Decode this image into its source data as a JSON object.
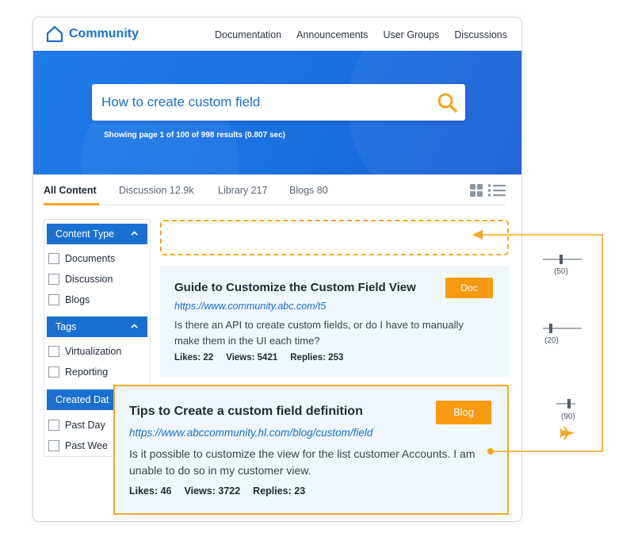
{
  "app": {
    "title": "Community"
  },
  "nav": [
    "Documentation",
    "Announcements",
    "User Groups",
    "Discussions"
  ],
  "search": {
    "value": "How to create custom field",
    "results_text": "Showing page 1 of 100 of 998 results (0.807 sec)"
  },
  "tabs": [
    {
      "label": "All Content"
    },
    {
      "label": "Discussion 12.9k"
    },
    {
      "label": "Library 217"
    },
    {
      "label": "Blogs 80"
    }
  ],
  "filters": {
    "content_type": {
      "header": "Content Type",
      "items": [
        "Documents",
        "Discussion",
        "Blogs"
      ]
    },
    "tags": {
      "header": "Tags",
      "items": [
        "Virtualization",
        "Reporting"
      ]
    },
    "created_date": {
      "header": "Created Dat",
      "items": [
        "Past Day",
        "Past Wee"
      ]
    }
  },
  "results": [
    {
      "title": "Guide to Customize the Custom Field View",
      "badge": "Doc",
      "link": "https://www.community.abc.com/t5",
      "description": "Is there an API to create custom fields, or do I have to manually make them in the UI each time?",
      "likes": "Likes: 22",
      "views": "Views: 5421",
      "replies": "Replies: 253"
    },
    {
      "title": "Tips to Create a custom field definition",
      "badge": "Blog",
      "link": "https://www.abccommunity.hl.com/blog/custom/field",
      "description": "Is it possible to customize the view for the list customer Accounts. I am unable to do so in my customer view.",
      "likes": "Likes: 46",
      "views": "Views: 3722",
      "replies": "Replies: 23"
    }
  ],
  "sliders": [
    {
      "label": "(50)"
    },
    {
      "label": "(20)"
    },
    {
      "label": "(90)"
    }
  ],
  "colors": {
    "brand": "#1a6fd0",
    "accent": "#f5a623",
    "badge": "#f79a12"
  }
}
